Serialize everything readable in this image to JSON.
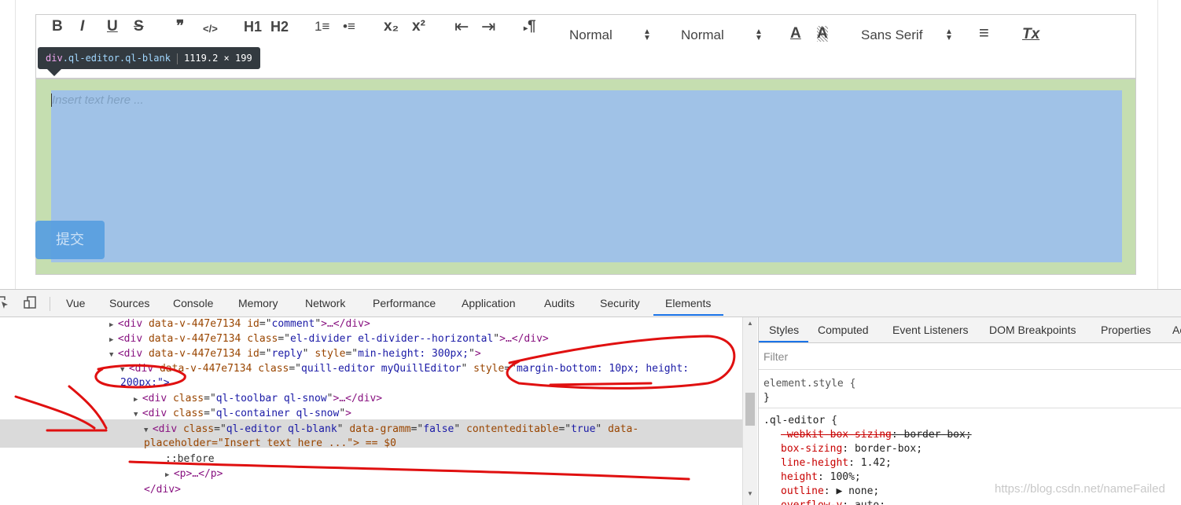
{
  "toolbar": {
    "bold": "B",
    "italic": "I",
    "underline": "U",
    "strike": "S",
    "blockquote": "❞",
    "code": "</>",
    "h1": "H1",
    "h2": "H2",
    "ordered_list": "1≡",
    "bullet_list": "•≡",
    "subscript": "x₂",
    "superscript": "x²",
    "outdent": "⇤",
    "indent": "⇥",
    "direction": "¶",
    "size_select": "Normal",
    "header_select": "Normal",
    "color": "A",
    "background": "A",
    "font_select": "Sans Serif",
    "align": "≡",
    "clean": "Tx"
  },
  "tooltip": {
    "tag": "div",
    "classes": ".ql-editor.ql-blank",
    "size": "1119.2 × 199"
  },
  "editor": {
    "placeholder": "Insert text here ..."
  },
  "submit_button": "提交",
  "devtools": {
    "tabs": [
      "Vue",
      "Sources",
      "Console",
      "Memory",
      "Network",
      "Performance",
      "Application",
      "Audits",
      "Security",
      "Elements"
    ],
    "active_tab": "Elements",
    "elements": [
      {
        "indent": 0,
        "tri": "▶",
        "open": "<div",
        "attrs": [
          [
            "data-v-447e7134",
            ""
          ],
          [
            "id",
            "comment"
          ]
        ],
        "close": ">…</div>"
      },
      {
        "indent": 0,
        "tri": "▶",
        "open": "<div",
        "attrs": [
          [
            "data-v-447e7134",
            ""
          ],
          [
            "class",
            "el-divider el-divider--horizontal"
          ]
        ],
        "close": ">…</div>"
      },
      {
        "indent": 0,
        "tri": "▼",
        "open": "<div",
        "attrs": [
          [
            "data-v-447e7134",
            ""
          ],
          [
            "id",
            "reply"
          ],
          [
            "style",
            "min-height: 300px;"
          ]
        ],
        "close": ">"
      },
      {
        "indent": 1,
        "tri": "▼",
        "open": "<div",
        "attrs": [
          [
            "data-v-447e7134",
            ""
          ],
          [
            "class",
            "quill-editor myQuillEditor"
          ],
          [
            "style",
            "margin-bottom: 10px; height:"
          ]
        ],
        "close": ""
      },
      {
        "indent": 1,
        "tri": "",
        "open": "",
        "attrs": [],
        "close": "",
        "cont": "200px;\">"
      },
      {
        "indent": 2,
        "tri": "▶",
        "open": "<div",
        "attrs": [
          [
            "class",
            "ql-toolbar ql-snow"
          ]
        ],
        "close": ">…</div>"
      },
      {
        "indent": 2,
        "tri": "▼",
        "open": "<div",
        "attrs": [
          [
            "class",
            "ql-container ql-snow"
          ]
        ],
        "close": ">"
      },
      {
        "indent": 3,
        "tri": "▼",
        "open": "<div",
        "attrs": [
          [
            "class",
            "ql-editor ql-blank"
          ],
          [
            "data-gramm",
            "false"
          ],
          [
            "contenteditable",
            "true"
          ]
        ],
        "close": " data-"
      },
      {
        "indent": 2,
        "tri": "",
        "open": "",
        "attrs": [],
        "close": "",
        "cont": "placeholder=\"Insert text here ...\"> == $0"
      },
      {
        "indent": 4,
        "tri": "",
        "open": "",
        "attrs": [],
        "close": "",
        "cont": "::before"
      },
      {
        "indent": 4,
        "tri": "▶",
        "open": "<p",
        "attrs": [],
        "close": ">…</p>"
      },
      {
        "indent": 3,
        "tri": "",
        "open": "",
        "attrs": [],
        "close": "",
        "cont": "</div>"
      }
    ],
    "styles_tabs": [
      "Styles",
      "Computed",
      "Event Listeners",
      "DOM Breakpoints",
      "Properties",
      "Ac"
    ],
    "filter_placeholder": "Filter",
    "element_style": "element.style {",
    "element_style_close": "}",
    "rule_selector": ".ql-editor {",
    "rules": [
      {
        "prop": "-webkit-box-sizing",
        "val": "border-box;",
        "struck": true
      },
      {
        "prop": "box-sizing",
        "val": "border-box;",
        "struck": false
      },
      {
        "prop": "line-height",
        "val": "1.42;",
        "struck": false
      },
      {
        "prop": "height",
        "val": "100%;",
        "struck": false
      },
      {
        "prop": "outline",
        "val": "▶ none;",
        "struck": false
      },
      {
        "prop": "overflow-y",
        "val": "auto;",
        "struck": false
      }
    ]
  },
  "watermark": "https://blog.csdn.net/nameFailed",
  "colors": {
    "container_highlight": "#c5deb0",
    "editor_highlight": "#a0c2e7",
    "submit": "#5aa0e0",
    "annotation": "#e01010",
    "active_tab": "#1a73e8"
  }
}
